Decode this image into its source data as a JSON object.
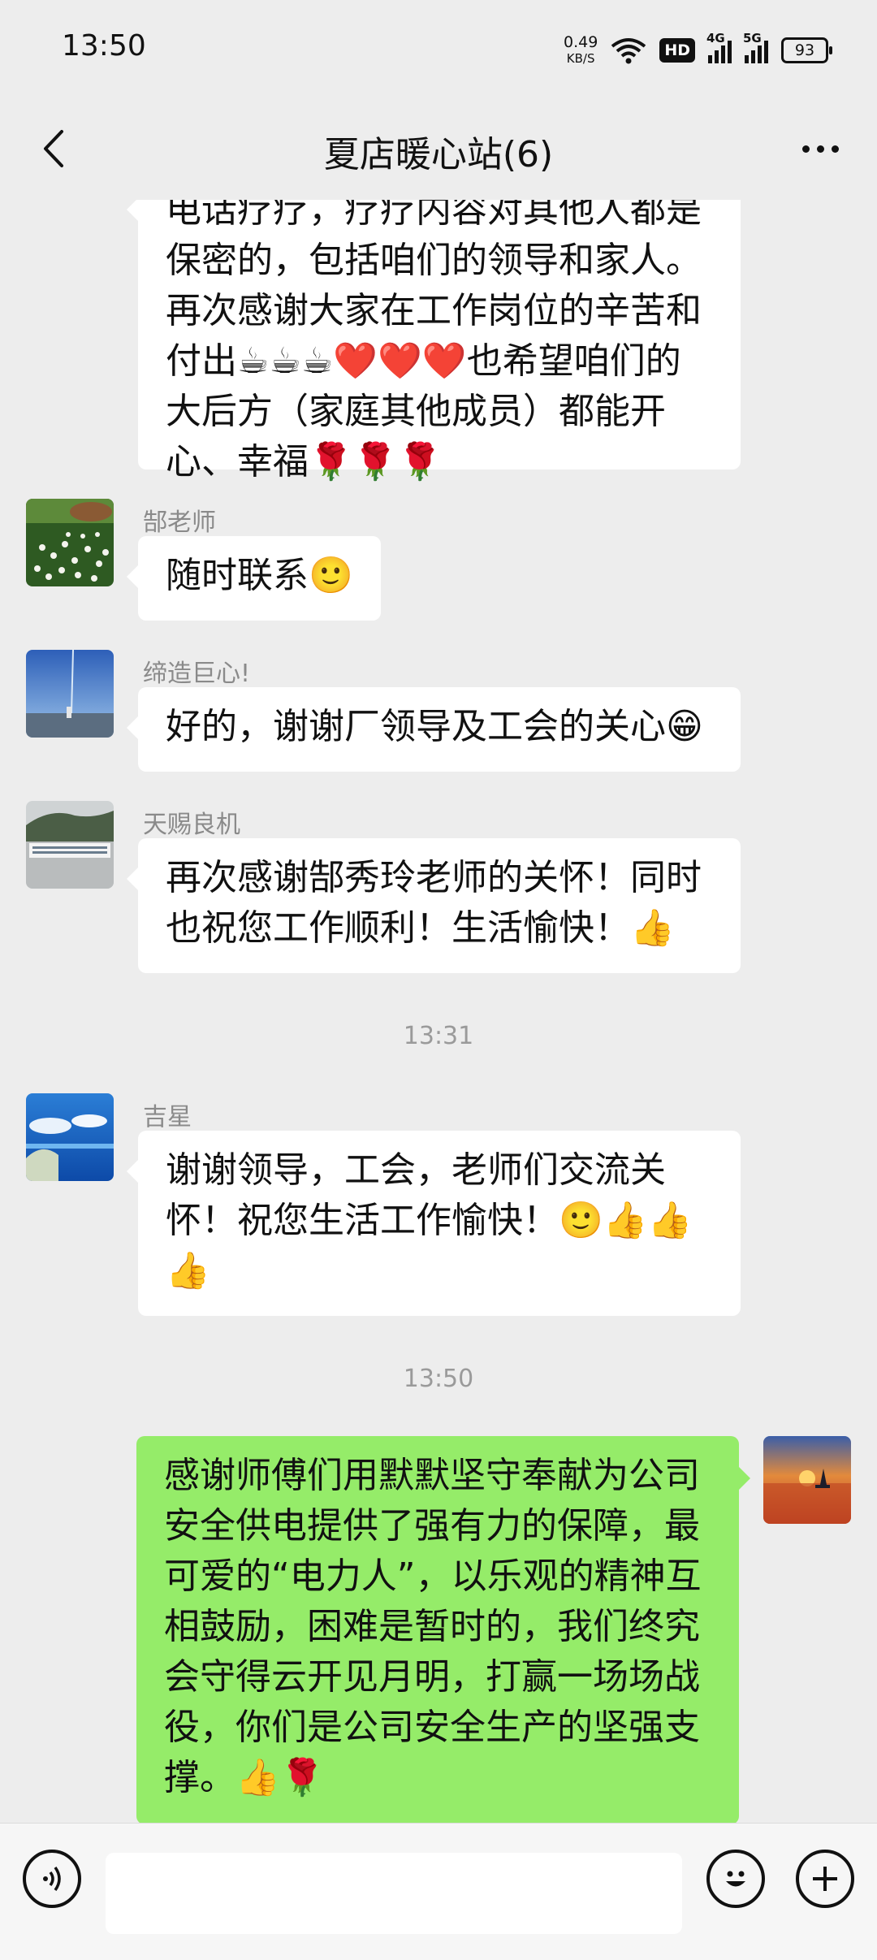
{
  "status_bar": {
    "time": "13:50",
    "net_speed_value": "0.49",
    "net_speed_unit": "KB/S",
    "hd_label": "HD",
    "signal1_label": "4G",
    "signal2_label": "5G",
    "battery": "93"
  },
  "nav": {
    "title": "夏店暖心站(6)"
  },
  "messages": [
    {
      "type": "incoming",
      "lines": [
        "电话疗疗，疗疗内容对其他人都是",
        "保密的，包括咱们的领导和家人。",
        "再次感谢大家在工作岗位的辛苦和",
        "付出☕☕☕❤️❤️❤️也希望咱们的",
        "大后方（家庭其他成员）都能开",
        "心、幸福🌹🌹🌹"
      ]
    },
    {
      "type": "incoming",
      "sender": "郜老师",
      "text": "随时联系🙂"
    },
    {
      "type": "incoming",
      "sender": "缔造巨心!",
      "text": "好的，谢谢厂领导及工会的关心😁"
    },
    {
      "type": "incoming",
      "sender": "天赐良机",
      "lines": [
        "再次感谢郜秀玲老师的关怀！同时",
        "也祝您工作顺利！生活愉快！👍"
      ]
    },
    {
      "type": "time",
      "text": "13:31"
    },
    {
      "type": "incoming",
      "sender": "吉星",
      "lines": [
        "谢谢领导，工会，老师们交流关",
        "怀！祝您生活工作愉快！🙂👍👍",
        "👍"
      ]
    },
    {
      "type": "time",
      "text": "13:50"
    },
    {
      "type": "outgoing",
      "lines": [
        "感谢师傅们用默默坚守奉献为公司",
        "安全供电提供了强有力的保障，最",
        "可爱的“电力人”，以乐观的精神互",
        "相鼓励，困难是暂时的，我们终究",
        "会守得云开见月明，打赢一场场战",
        "役，你们是公司安全生产的坚强支",
        "撑。👍🌹"
      ]
    }
  ],
  "input_bar": {
    "placeholder": ""
  },
  "colors": {
    "background": "#ededed",
    "self_bubble": "#95ec69",
    "other_bubble": "#ffffff"
  }
}
